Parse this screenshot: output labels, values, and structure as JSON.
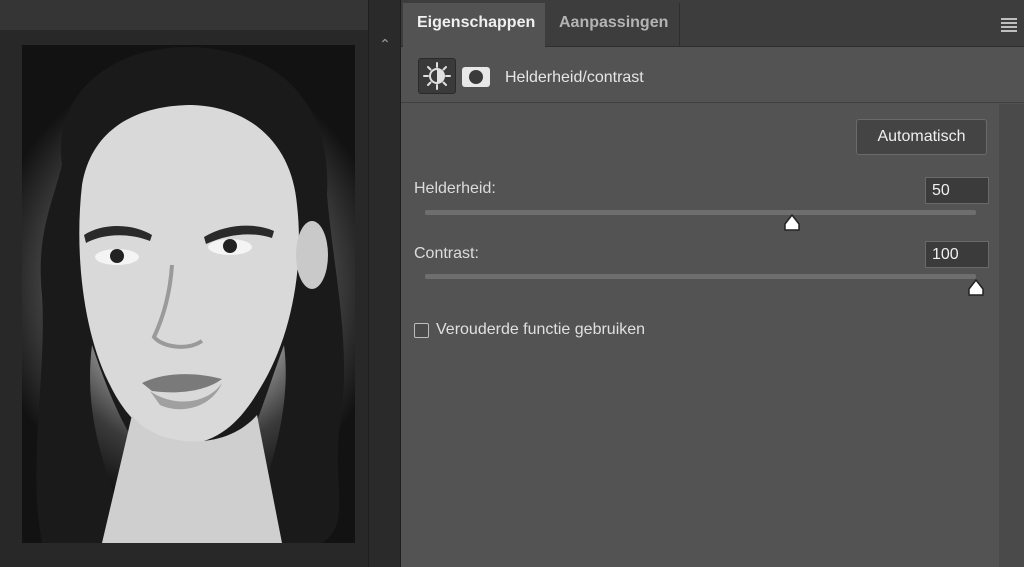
{
  "tabs": [
    {
      "label": "Eigenschappen",
      "active": true
    },
    {
      "label": "Aanpassingen",
      "active": false
    }
  ],
  "panel_menu_icon": "hamburger-menu-icon",
  "adjustment": {
    "icon": "brightness-contrast-icon",
    "mask_icon": "layer-mask-icon",
    "title": "Helderheid/contrast"
  },
  "auto_button": "Automatisch",
  "brightness": {
    "label": "Helderheid:",
    "value": "50",
    "min": -150,
    "max": 150
  },
  "contrast": {
    "label": "Contrast:",
    "value": "100",
    "min": -50,
    "max": 100
  },
  "legacy": {
    "label": "Verouderde functie gebruiken",
    "checked": false
  },
  "colors": {
    "panel_bg": "#535353",
    "tab_bar_bg": "#3d3d3d",
    "canvas_bg": "#282828"
  }
}
